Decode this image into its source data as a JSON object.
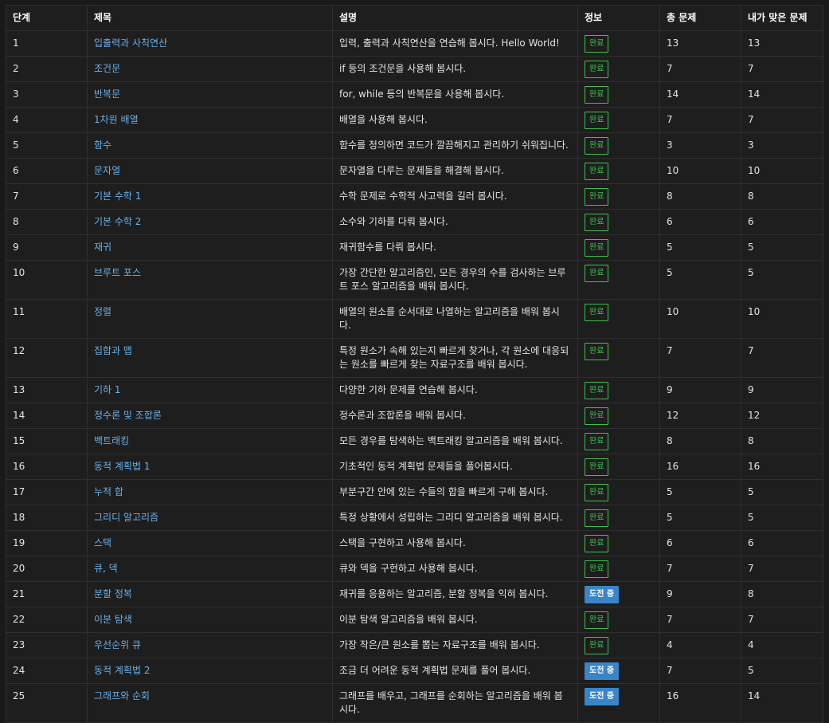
{
  "headers": {
    "step": "단계",
    "title": "제목",
    "desc": "설명",
    "info": "정보",
    "total": "총 문제",
    "mine": "내가 맞은 문제"
  },
  "colors": {
    "done": "#3fbf4f",
    "trying": "#3a85c9",
    "link": "#6ab0e8"
  },
  "rows": [
    {
      "step": "1",
      "title": "입출력과 사칙연산",
      "desc": "입력, 출력과 사칙연산을 연습해 봅시다. Hello World!",
      "status": "완료",
      "state": "done",
      "total": "13",
      "mine": "13"
    },
    {
      "step": "2",
      "title": "조건문",
      "desc": "if 등의 조건문을 사용해 봅시다.",
      "status": "완료",
      "state": "done",
      "total": "7",
      "mine": "7"
    },
    {
      "step": "3",
      "title": "반복문",
      "desc": "for, while 등의 반복문을 사용해 봅시다.",
      "status": "완료",
      "state": "done",
      "total": "14",
      "mine": "14"
    },
    {
      "step": "4",
      "title": "1차원 배열",
      "desc": "배열을 사용해 봅시다.",
      "status": "완료",
      "state": "done",
      "total": "7",
      "mine": "7"
    },
    {
      "step": "5",
      "title": "함수",
      "desc": "함수를 정의하면 코드가 깔끔해지고 관리하기 쉬워집니다.",
      "status": "완료",
      "state": "done",
      "total": "3",
      "mine": "3"
    },
    {
      "step": "6",
      "title": "문자열",
      "desc": "문자열을 다루는 문제들을 해결해 봅시다.",
      "status": "완료",
      "state": "done",
      "total": "10",
      "mine": "10"
    },
    {
      "step": "7",
      "title": "기본 수학 1",
      "desc": "수학 문제로 수학적 사고력을 길러 봅시다.",
      "status": "완료",
      "state": "done",
      "total": "8",
      "mine": "8"
    },
    {
      "step": "8",
      "title": "기본 수학 2",
      "desc": "소수와 기하를 다뤄 봅시다.",
      "status": "완료",
      "state": "done",
      "total": "6",
      "mine": "6"
    },
    {
      "step": "9",
      "title": "재귀",
      "desc": "재귀함수를 다뤄 봅시다.",
      "status": "완료",
      "state": "done",
      "total": "5",
      "mine": "5"
    },
    {
      "step": "10",
      "title": "브루트 포스",
      "desc": "가장 간단한 알고리즘인, 모든 경우의 수를 검사하는 브루트 포스 알고리즘을 배워 봅시다.",
      "status": "완료",
      "state": "done",
      "total": "5",
      "mine": "5"
    },
    {
      "step": "11",
      "title": "정렬",
      "desc": "배열의 원소를 순서대로 나열하는 알고리즘을 배워 봅시다.",
      "status": "완료",
      "state": "done",
      "total": "10",
      "mine": "10"
    },
    {
      "step": "12",
      "title": "집합과 맵",
      "desc": "특정 원소가 속해 있는지 빠르게 찾거나, 각 원소에 대응되는 원소를 빠르게 찾는 자료구조를 배워 봅시다.",
      "status": "완료",
      "state": "done",
      "total": "7",
      "mine": "7"
    },
    {
      "step": "13",
      "title": "기하 1",
      "desc": "다양한 기하 문제를 연습해 봅시다.",
      "status": "완료",
      "state": "done",
      "total": "9",
      "mine": "9"
    },
    {
      "step": "14",
      "title": "정수론 및 조합론",
      "desc": "정수론과 조합론을 배워 봅시다.",
      "status": "완료",
      "state": "done",
      "total": "12",
      "mine": "12"
    },
    {
      "step": "15",
      "title": "백트래킹",
      "desc": "모든 경우를 탐색하는 백트래킹 알고리즘을 배워 봅시다.",
      "status": "완료",
      "state": "done",
      "total": "8",
      "mine": "8"
    },
    {
      "step": "16",
      "title": "동적 계획법 1",
      "desc": "기초적인 동적 계획법 문제들을 풀어봅시다.",
      "status": "완료",
      "state": "done",
      "total": "16",
      "mine": "16"
    },
    {
      "step": "17",
      "title": "누적 합",
      "desc": "부분구간 안에 있는 수들의 합을 빠르게 구해 봅시다.",
      "status": "완료",
      "state": "done",
      "total": "5",
      "mine": "5"
    },
    {
      "step": "18",
      "title": "그리디 알고리즘",
      "desc": "특정 상황에서 성립하는 그리디 알고리즘을 배워 봅시다.",
      "status": "완료",
      "state": "done",
      "total": "5",
      "mine": "5"
    },
    {
      "step": "19",
      "title": "스택",
      "desc": "스택을 구현하고 사용해 봅시다.",
      "status": "완료",
      "state": "done",
      "total": "6",
      "mine": "6"
    },
    {
      "step": "20",
      "title": "큐, 덱",
      "desc": "큐와 덱을 구현하고 사용해 봅시다.",
      "status": "완료",
      "state": "done",
      "total": "7",
      "mine": "7"
    },
    {
      "step": "21",
      "title": "분할 정복",
      "desc": "재귀를 응용하는 알고리즘, 분할 정복을 익혀 봅시다.",
      "status": "도전 중",
      "state": "trying",
      "total": "9",
      "mine": "8"
    },
    {
      "step": "22",
      "title": "이분 탐색",
      "desc": "이분 탐색 알고리즘을 배워 봅시다.",
      "status": "완료",
      "state": "done",
      "total": "7",
      "mine": "7"
    },
    {
      "step": "23",
      "title": "우선순위 큐",
      "desc": "가장 작은/큰 원소를 뽑는 자료구조를 배워 봅시다.",
      "status": "완료",
      "state": "done",
      "total": "4",
      "mine": "4"
    },
    {
      "step": "24",
      "title": "동적 계획법 2",
      "desc": "조금 더 어려운 동적 계획법 문제를 풀어 봅시다.",
      "status": "도전 중",
      "state": "trying",
      "total": "7",
      "mine": "5"
    },
    {
      "step": "25",
      "title": "그래프와 순회",
      "desc": "그래프를 배우고, 그래프를 순회하는 알고리즘을 배워 봅시다.",
      "status": "도전 중",
      "state": "trying",
      "total": "16",
      "mine": "14"
    }
  ]
}
